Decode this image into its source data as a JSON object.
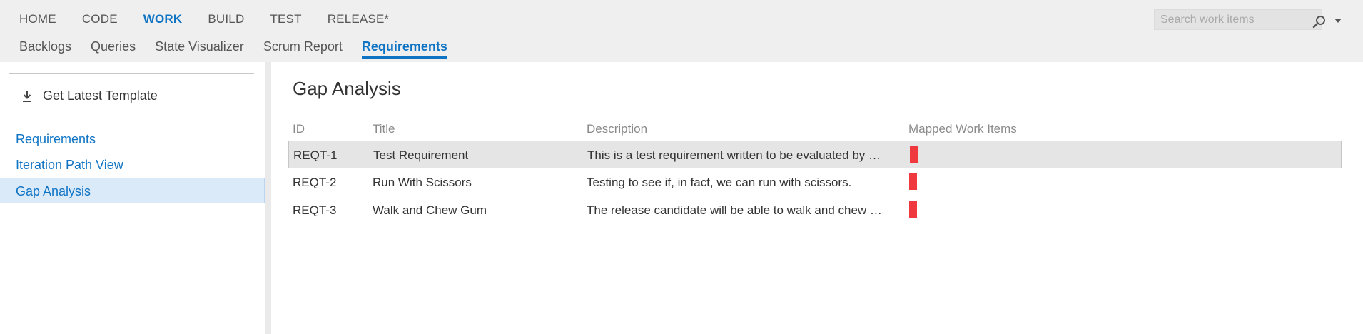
{
  "header": {
    "hubs": [
      "HOME",
      "CODE",
      "WORK",
      "BUILD",
      "TEST",
      "RELEASE*"
    ],
    "active_hub": "WORK",
    "tabs": [
      "Backlogs",
      "Queries",
      "State Visualizer",
      "Scrum Report",
      "Requirements"
    ],
    "active_tab": "Requirements",
    "search": {
      "placeholder": "Search work items",
      "value": ""
    }
  },
  "sidebar": {
    "toolbar_label": "Get Latest Template",
    "items": [
      "Requirements",
      "Iteration Path View",
      "Gap Analysis"
    ],
    "selected": "Gap Analysis"
  },
  "main": {
    "title": "Gap Analysis",
    "columns": [
      "ID",
      "Title",
      "Description",
      "Mapped Work Items"
    ],
    "rows": [
      {
        "id": "REQT-1",
        "title": "Test Requirement",
        "description": "This is a test requirement written to be evaluated by …",
        "mapped_status": "red"
      },
      {
        "id": "REQT-2",
        "title": "Run With Scissors",
        "description": "Testing to see if, in fact, we can run with scissors.",
        "mapped_status": "red"
      },
      {
        "id": "REQT-3",
        "title": "Walk and Chew Gum",
        "description": "The release candidate will be able to walk and chew …",
        "mapped_status": "red"
      }
    ],
    "selected_row": 0
  },
  "colors": {
    "accent": "#0f74c4",
    "header_bg": "#efefef",
    "selection_bg": "#dbeaf9",
    "mapped_red": "#f0383f"
  },
  "icons": {
    "toolbar": "download-icon",
    "search": "search-icon",
    "search_menu": "chevron-down-icon"
  }
}
